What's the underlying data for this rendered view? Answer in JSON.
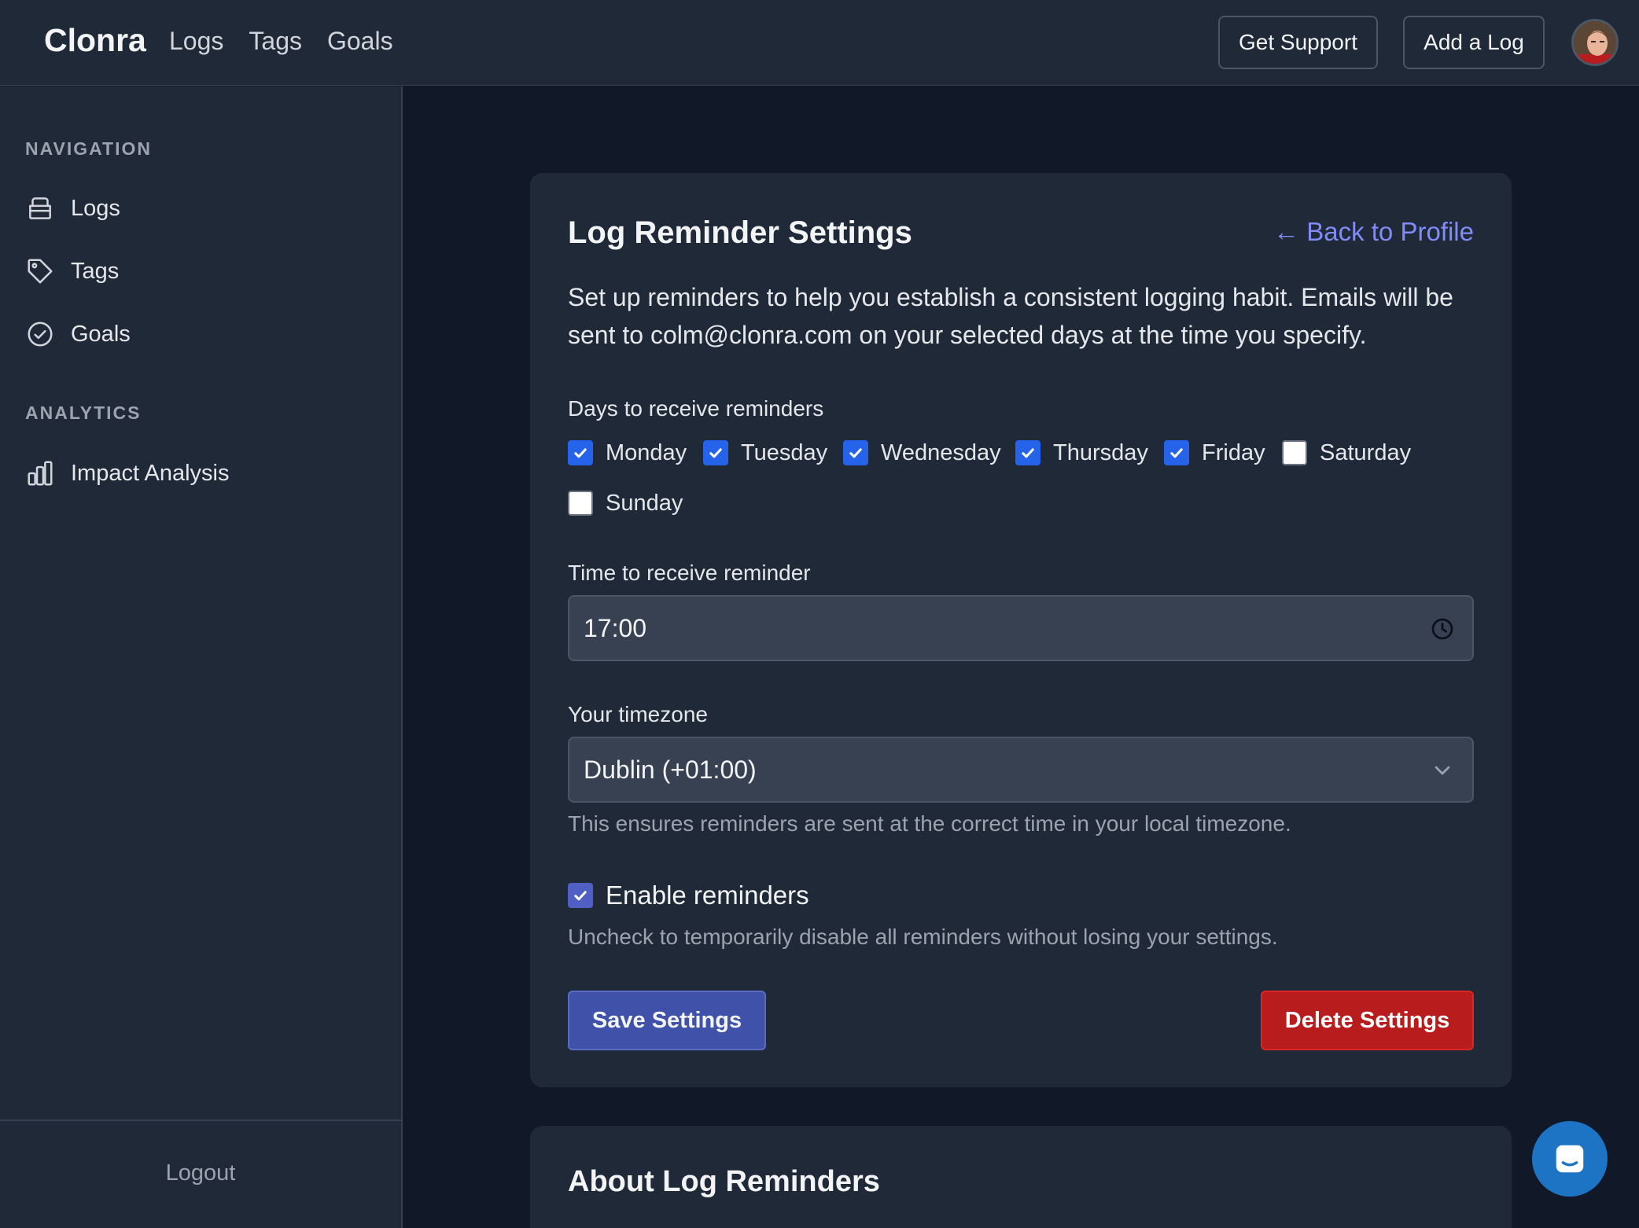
{
  "app": {
    "brand": "Clonra"
  },
  "topnav": {
    "items": [
      {
        "label": "Logs"
      },
      {
        "label": "Tags"
      },
      {
        "label": "Goals"
      }
    ],
    "support_label": "Get Support",
    "add_log_label": "Add a Log"
  },
  "sidebar": {
    "navigation_heading": "NAVIGATION",
    "nav_items": [
      {
        "label": "Logs",
        "icon": "inbox-icon"
      },
      {
        "label": "Tags",
        "icon": "tag-icon"
      },
      {
        "label": "Goals",
        "icon": "check-circle-icon"
      }
    ],
    "analytics_heading": "ANALYTICS",
    "analytics_items": [
      {
        "label": "Impact Analysis",
        "icon": "bar-chart-icon"
      }
    ],
    "logout_label": "Logout"
  },
  "settings": {
    "title": "Log Reminder Settings",
    "back_link": "← Back to Profile",
    "description": "Set up reminders to help you establish a consistent logging habit. Emails will be sent to colm@clonra.com on your selected days at the time you specify.",
    "days_label": "Days to receive reminders",
    "days": [
      {
        "label": "Monday",
        "checked": true
      },
      {
        "label": "Tuesday",
        "checked": true
      },
      {
        "label": "Wednesday",
        "checked": true
      },
      {
        "label": "Thursday",
        "checked": true
      },
      {
        "label": "Friday",
        "checked": true
      },
      {
        "label": "Saturday",
        "checked": false
      },
      {
        "label": "Sunday",
        "checked": false
      }
    ],
    "time_label": "Time to receive reminder",
    "time_value": "17:00",
    "timezone_label": "Your timezone",
    "timezone_value": "Dublin (+01:00)",
    "timezone_hint": "This ensures reminders are sent at the correct time in your local timezone.",
    "enable_label": "Enable reminders",
    "enable_checked": true,
    "enable_hint": "Uncheck to temporarily disable all reminders without losing your settings.",
    "save_label": "Save Settings",
    "delete_label": "Delete Settings"
  },
  "about": {
    "title": "About Log Reminders"
  },
  "colors": {
    "page_bg": "#111827",
    "panel_bg": "#1f2937",
    "checkbox_on": "#2563eb",
    "primary_button": "#3f51a8",
    "danger_button": "#b91c1c",
    "link": "#818cf8",
    "chat_bubble": "#1d74c4"
  }
}
